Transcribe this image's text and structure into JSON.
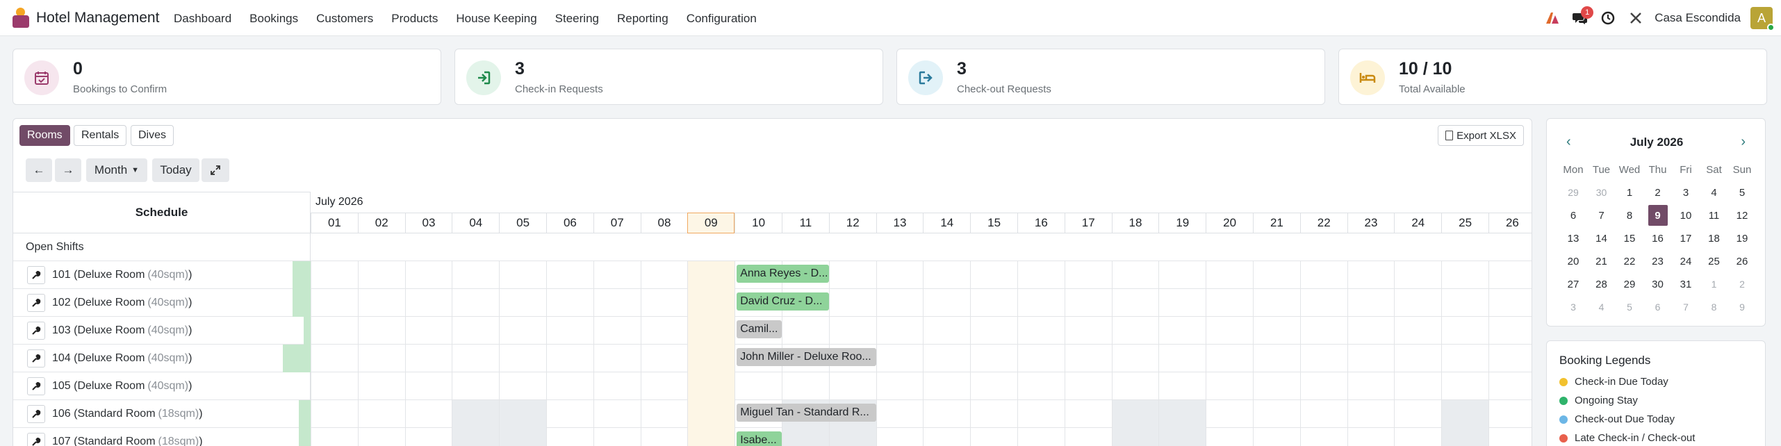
{
  "navbar": {
    "app_name": "Hotel Management",
    "menu": [
      "Dashboard",
      "Bookings",
      "Customers",
      "Products",
      "House Keeping",
      "Steering",
      "Reporting",
      "Configuration"
    ],
    "message_count": "1",
    "company": "Casa Escondida",
    "avatar_letter": "A"
  },
  "kpis": [
    {
      "value": "0",
      "label": "Bookings to Confirm",
      "icon": "calendar-check-icon",
      "icon_bg": "#f6e6ee",
      "icon_color": "#9b3b6c"
    },
    {
      "value": "3",
      "label": "Check-in Requests",
      "icon": "sign-in-icon",
      "icon_bg": "#e3f4ea",
      "icon_color": "#1f8a4c"
    },
    {
      "value": "3",
      "label": "Check-out Requests",
      "icon": "sign-out-icon",
      "icon_bg": "#e2f2f8",
      "icon_color": "#2a7a9c"
    },
    {
      "value": "10 / 10",
      "label": "Total Available",
      "icon": "bed-icon",
      "icon_bg": "#fdf3d6",
      "icon_color": "#c98a10"
    }
  ],
  "schedule": {
    "tabs": [
      {
        "label": "Rooms",
        "active": true
      },
      {
        "label": "Rentals",
        "active": false
      },
      {
        "label": "Dives",
        "active": false
      }
    ],
    "export_label": "Export XLSX",
    "toolbar": {
      "prev": "←",
      "next": "→",
      "range": "Month",
      "today": "Today"
    },
    "header_label": "Schedule",
    "month_label": "July 2026",
    "days": [
      "01",
      "02",
      "03",
      "04",
      "05",
      "06",
      "07",
      "08",
      "09",
      "10",
      "11",
      "12",
      "13",
      "14",
      "15",
      "16",
      "17",
      "18",
      "19",
      "20",
      "21",
      "22",
      "23",
      "24",
      "25",
      "26"
    ],
    "today_index": 8,
    "open_shifts_label": "Open Shifts",
    "rows": [
      {
        "name": "101 (Deluxe Room",
        "size": "(40sqm)",
        "occ": 0.3,
        "shades": [],
        "bookings": [
          {
            "text": "Anna Reyes - D...",
            "start": 9,
            "end": 11,
            "color": "green"
          }
        ]
      },
      {
        "name": "102 (Deluxe Room",
        "size": "(40sqm)",
        "occ": 0.3,
        "shades": [],
        "bookings": [
          {
            "text": "David Cruz - D...",
            "start": 9,
            "end": 11,
            "color": "green"
          }
        ]
      },
      {
        "name": "103 (Deluxe Room",
        "size": "(40sqm)",
        "occ": 0.1,
        "shades": [],
        "bookings": [
          {
            "text": "Camil...",
            "start": 9,
            "end": 10,
            "color": "gray"
          }
        ]
      },
      {
        "name": "104 (Deluxe Room",
        "size": "(40sqm)",
        "occ": 0.5,
        "shades": [],
        "bookings": [
          {
            "text": "John Miller - Deluxe Roo...",
            "start": 9,
            "end": 12,
            "color": "gray"
          }
        ]
      },
      {
        "name": "105 (Deluxe Room",
        "size": "(40sqm)",
        "occ": 0.0,
        "shades": [],
        "bookings": []
      },
      {
        "name": "106 (Standard Room",
        "size": "(18sqm)",
        "occ": 0.2,
        "shades": [
          [
            3,
            5
          ],
          [
            10,
            12
          ],
          [
            17,
            19
          ],
          [
            24,
            25
          ]
        ],
        "bookings": [
          {
            "text": "Miguel Tan - Standard R...",
            "start": 9,
            "end": 12,
            "color": "gray"
          }
        ]
      },
      {
        "name": "107 (Standard Room",
        "size": "(18sqm)",
        "occ": 0.2,
        "shades": [
          [
            3,
            5
          ],
          [
            10,
            12
          ],
          [
            17,
            19
          ],
          [
            24,
            25
          ]
        ],
        "bookings": [
          {
            "text": "Isabe...",
            "start": 9,
            "end": 10,
            "color": "green"
          }
        ]
      }
    ]
  },
  "calendar": {
    "title": "July 2026",
    "weekdays": [
      "Mon",
      "Tue",
      "Wed",
      "Thu",
      "Fri",
      "Sat",
      "Sun"
    ],
    "weeks": [
      [
        "29",
        "30",
        "1",
        "2",
        "3",
        "4",
        "5"
      ],
      [
        "6",
        "7",
        "8",
        "9",
        "10",
        "11",
        "12"
      ],
      [
        "13",
        "14",
        "15",
        "16",
        "17",
        "18",
        "19"
      ],
      [
        "20",
        "21",
        "22",
        "23",
        "24",
        "25",
        "26"
      ],
      [
        "27",
        "28",
        "29",
        "30",
        "31",
        "1",
        "2"
      ],
      [
        "3",
        "4",
        "5",
        "6",
        "7",
        "8",
        "9"
      ]
    ],
    "selected": "9"
  },
  "legend": {
    "title": "Booking Legends",
    "items": [
      {
        "label": "Check-in Due Today",
        "color": "#f2c12e"
      },
      {
        "label": "Ongoing Stay",
        "color": "#2fb36b"
      },
      {
        "label": "Check-out Due Today",
        "color": "#6cb6e6"
      },
      {
        "label": "Late Check-in / Check-out",
        "color": "#e8604c"
      }
    ]
  }
}
